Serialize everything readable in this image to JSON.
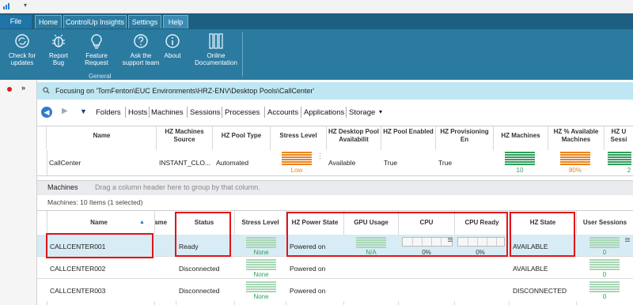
{
  "ribbon": {
    "tabs": [
      "File",
      "Home",
      "ControlUp Insights",
      "Settings",
      "Help"
    ],
    "buttons": [
      {
        "label": "Check for\nupdates",
        "icon": "refresh-icon"
      },
      {
        "label": "Report\nBug",
        "icon": "bug-icon"
      },
      {
        "label": "Feature\nRequest",
        "icon": "lightbulb-icon"
      },
      {
        "label": "Ask the\nsupport team",
        "icon": "question-icon"
      },
      {
        "label": "About",
        "icon": "info-icon"
      },
      {
        "label": "Online\nDocumentation",
        "icon": "documentation-icon"
      }
    ],
    "group_label": "General"
  },
  "focus": {
    "text": "Focusing on 'TomFenton\\EUC Environments\\HRZ-ENV\\Desktop Pools\\CallCenter'"
  },
  "nav": {
    "links": [
      "Folders",
      "Hosts",
      "Machines",
      "Sessions",
      "Processes",
      "Accounts",
      "Applications",
      "Storage"
    ],
    "storage_caret": "▾"
  },
  "pool_grid": {
    "headers": [
      "Name",
      "HZ Machines Source",
      "HZ Pool Type",
      "Stress Level",
      "HZ Desktop Pool Availabilit",
      "HZ Pool Enabled",
      "HZ Provisioning En",
      "HZ Machines",
      "HZ % Available Machines",
      "HZ U Sessi"
    ],
    "row": {
      "name": "CallCenter",
      "source": "INSTANT_CLO...",
      "pool_type": "Automated",
      "stress": "Low",
      "availability": "Available",
      "enabled": "True",
      "provisioning": "True",
      "machines": "10",
      "available_pct": "80%",
      "sessions_partial": "2"
    }
  },
  "machines": {
    "title": "Machines",
    "drag_hint": "Drag a column header here to group by that column.",
    "count": "Machines: 10 Items (1 selected)",
    "headers": [
      "Name",
      "ame",
      "Status",
      "Stress Level",
      "HZ Power State",
      "GPU Usage",
      "CPU",
      "CPU Ready",
      "HZ State",
      "User Sessions"
    ],
    "rows": [
      {
        "name": "CALLCENTER001",
        "status": "Ready",
        "stress": "None",
        "power": "Powered on",
        "gpu": "N/A",
        "cpu": "0%",
        "cpu_ready": "0%",
        "hz_state": "AVAILABLE",
        "sessions": "0"
      },
      {
        "name": "CALLCENTER002",
        "status": "Disconnected",
        "stress": "None",
        "power": "Powered on",
        "gpu": "",
        "cpu": "",
        "cpu_ready": "",
        "hz_state": "AVAILABLE",
        "sessions": "0"
      },
      {
        "name": "CALLCENTER003",
        "status": "Disconnected",
        "stress": "None",
        "power": "Powered on",
        "gpu": "",
        "cpu": "",
        "cpu_ready": "",
        "hz_state": "DISCONNECTED",
        "sessions": "0"
      }
    ]
  },
  "colors": {
    "ribbon_dark": "#1d5f80",
    "ribbon": "#2b7aa0",
    "focus_bar": "#bfe7f3",
    "highlight": "#e0151b",
    "stress_low": "#e8831f",
    "ok_green": "#2f9e5a"
  }
}
